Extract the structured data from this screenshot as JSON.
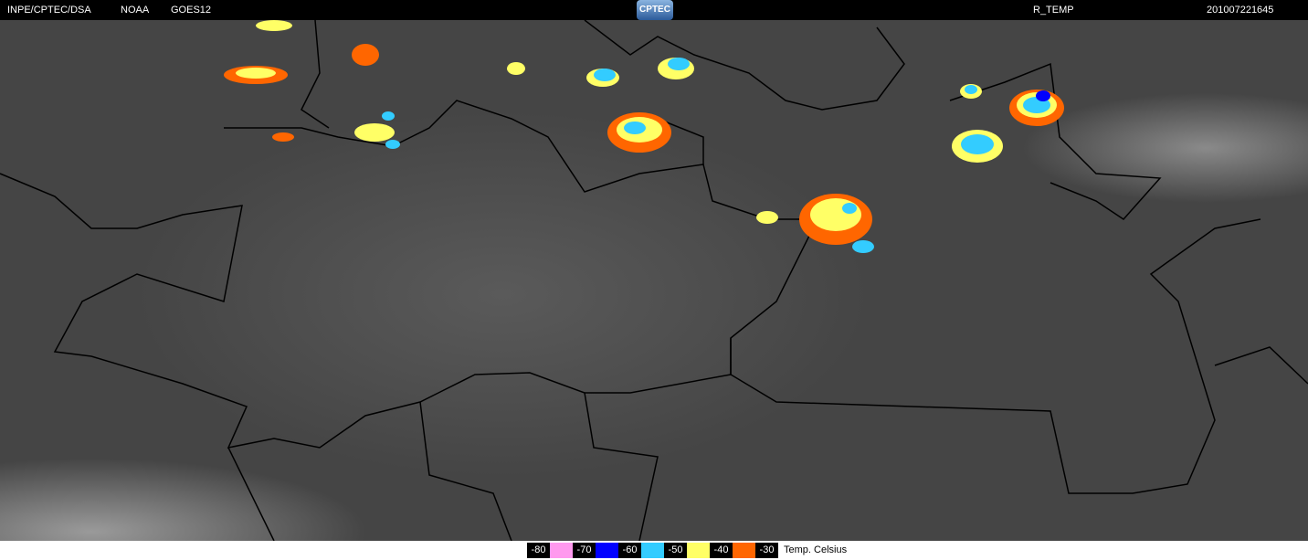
{
  "header": {
    "source": "INPE/CPTEC/DSA",
    "agency": "NOAA",
    "satellite": "GOES12",
    "logo": "CPTEC",
    "product": "R_TEMP",
    "timestamp": "201007221645"
  },
  "legend": {
    "items": [
      {
        "label": "-80",
        "color": "#ff99ee"
      },
      {
        "label": "-70",
        "color": "#0000ff"
      },
      {
        "label": "-60",
        "color": "#33ccff"
      },
      {
        "label": "-50",
        "color": "#ffff66"
      },
      {
        "label": "-40",
        "color": "#ff6600"
      },
      {
        "label": "-30",
        "color": null
      }
    ],
    "unit": "Temp. Celsius"
  }
}
